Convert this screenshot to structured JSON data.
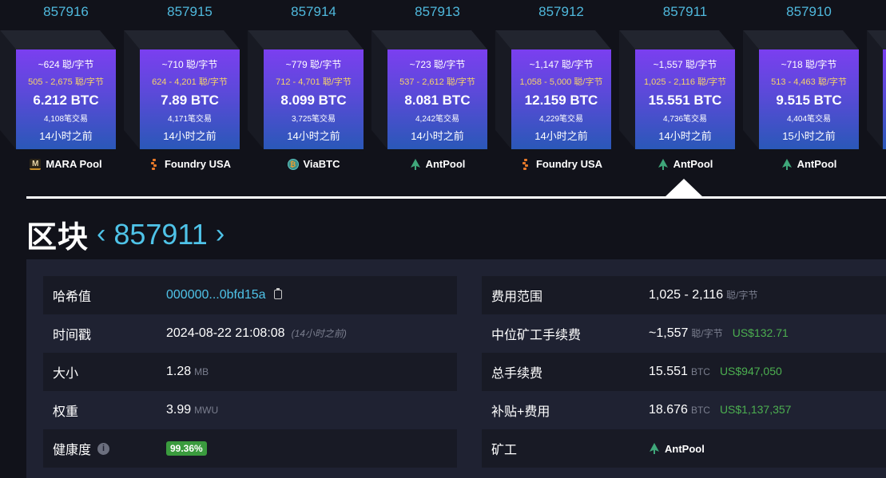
{
  "blocks": [
    {
      "height": "857916",
      "median_fee": "~624 聪/字节",
      "fee_range": "505 - 2,675 聪/字节",
      "reward": "6.212 BTC",
      "tx_count": "4,108笔交易",
      "time_ago": "14小时之前",
      "pool": "MARA Pool",
      "pool_icon": "mara-pool-icon"
    },
    {
      "height": "857915",
      "median_fee": "~710 聪/字节",
      "fee_range": "624 - 4,201 聪/字节",
      "reward": "7.89 BTC",
      "tx_count": "4,171笔交易",
      "time_ago": "14小时之前",
      "pool": "Foundry USA",
      "pool_icon": "foundry-usa-icon"
    },
    {
      "height": "857914",
      "median_fee": "~779 聪/字节",
      "fee_range": "712 - 4,701 聪/字节",
      "reward": "8.099 BTC",
      "tx_count": "3,725笔交易",
      "time_ago": "14小时之前",
      "pool": "ViaBTC",
      "pool_icon": "viabtc-icon"
    },
    {
      "height": "857913",
      "median_fee": "~723 聪/字节",
      "fee_range": "537 - 2,612 聪/字节",
      "reward": "8.081 BTC",
      "tx_count": "4,242笔交易",
      "time_ago": "14小时之前",
      "pool": "AntPool",
      "pool_icon": "antpool-icon"
    },
    {
      "height": "857912",
      "median_fee": "~1,147 聪/字节",
      "fee_range": "1,058 - 5,000 聪/字节",
      "reward": "12.159 BTC",
      "tx_count": "4,229笔交易",
      "time_ago": "14小时之前",
      "pool": "Foundry USA",
      "pool_icon": "foundry-usa-icon"
    },
    {
      "height": "857911",
      "median_fee": "~1,557 聪/字节",
      "fee_range": "1,025 - 2,116 聪/字节",
      "reward": "15.551 BTC",
      "tx_count": "4,736笔交易",
      "time_ago": "14小时之前",
      "pool": "AntPool",
      "pool_icon": "antpool-icon",
      "selected": true
    },
    {
      "height": "857910",
      "median_fee": "~718 聪/字节",
      "fee_range": "513 - 4,463 聪/字节",
      "reward": "9.515 BTC",
      "tx_count": "4,404笔交易",
      "time_ago": "15小时之前",
      "pool": "AntPool",
      "pool_icon": "antpool-icon"
    }
  ],
  "title": {
    "label": "区块",
    "prev_icon": "chevron-left-icon",
    "prev_glyph": "‹",
    "height": "857911",
    "next_icon": "chevron-right-icon",
    "next_glyph": "›"
  },
  "details_left": {
    "hash": {
      "label": "哈希值",
      "value": "000000...0bfd15a",
      "icon": "copy-icon"
    },
    "timestamp": {
      "label": "时间戳",
      "value": "2024-08-22 21:08:08",
      "relative": "(14小时之前)"
    },
    "size": {
      "label": "大小",
      "value": "1.28",
      "unit": "MB"
    },
    "weight": {
      "label": "权重",
      "value": "3.99",
      "unit": "MWU"
    },
    "health": {
      "label": "健康度",
      "info_glyph": "i",
      "value": "99.36%"
    }
  },
  "details_right": {
    "fee_range": {
      "label": "费用范围",
      "value": "1,025 - 2,116",
      "unit": "聪/字节"
    },
    "median_fee": {
      "label": "中位矿工手续费",
      "value": "~1,557",
      "unit": "聪/字节",
      "usd": "US$132.71"
    },
    "total_fees": {
      "label": "总手续费",
      "value": "15.551",
      "unit": "BTC",
      "usd": "US$947,050"
    },
    "subsidy_fees": {
      "label": "补贴+费用",
      "value": "18.676",
      "unit": "BTC",
      "usd": "US$1,137,357"
    },
    "miner": {
      "label": "矿工",
      "value": "AntPool",
      "icon": "antpool-icon"
    }
  },
  "colors": {
    "accent": "#4fc3e8",
    "usd_green": "#4caf50",
    "fee_range_yellow": "#f4d36a",
    "block_gradient_top": "#7b3ff0",
    "block_gradient_bottom": "#2a58b8",
    "health_badge": "#3a9b3e"
  }
}
